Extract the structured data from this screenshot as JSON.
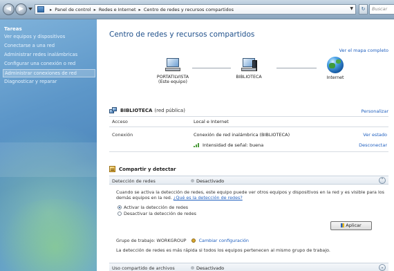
{
  "titlebar": {
    "breadcrumbs": [
      "Panel de control",
      "Redes e Internet",
      "Centro de redes y recursos compartidos"
    ],
    "search_placeholder": "Buscar",
    "refresh_icon": "refresh-icon"
  },
  "sidebar": {
    "title": "Tareas",
    "items": [
      "Ver equipos y dispositivos",
      "Conectarse a una red",
      "Administrar redes inalámbricas",
      "Configurar una conexión o red",
      "Administrar conexiones de red",
      "Diagnosticar y reparar"
    ]
  },
  "main": {
    "title": "Centro de redes y recursos compartidos",
    "full_map_link": "Ver el mapa completo",
    "nodes": {
      "this_pc": "PORTATILVISTA",
      "this_pc_sub": "(Este equipo)",
      "network": "BIBLIOTECA",
      "internet": "Internet"
    },
    "network_section": {
      "name": "BIBLIOTECA",
      "type": "(red pública)",
      "customize": "Personalizar",
      "access_label": "Acceso",
      "access_value": "Local e Internet",
      "connection_label": "Conexión",
      "connection_value": "Conexión de red inalámbrica (BIBLIOTECA)",
      "view_status": "Ver estado",
      "signal_value": "Intensidad de señal: buena",
      "disconnect": "Desconectar"
    },
    "sharing": {
      "title": "Compartir y detectar",
      "discovery_label": "Detección de redes",
      "discovery_value": "Desactivado",
      "description": "Cuando se activa la detección de redes, este equipo puede ver otros equipos y dispositivos en la red y es visible para los demás equipos en la red.",
      "description_link": "¿Qué es la detección de redes?",
      "radio_on": "Activar la detección de redes",
      "radio_off": "Desactivar la detección de redes",
      "apply": "Aplicar",
      "workgroup": "Grupo de trabajo: WORKGROUP",
      "change_settings": "Cambiar configuración",
      "workgroup_note": "La detección de redes es más rápida si todos los equipos pertenecen al mismo grupo de trabajo.",
      "file_sharing_label": "Uso compartido de archivos",
      "file_sharing_value": "Desactivado"
    }
  },
  "colors": {
    "title_blue": "#1e4f8a",
    "link_blue": "#1f5fbf",
    "sidebar_blue": "#5d97c9"
  }
}
